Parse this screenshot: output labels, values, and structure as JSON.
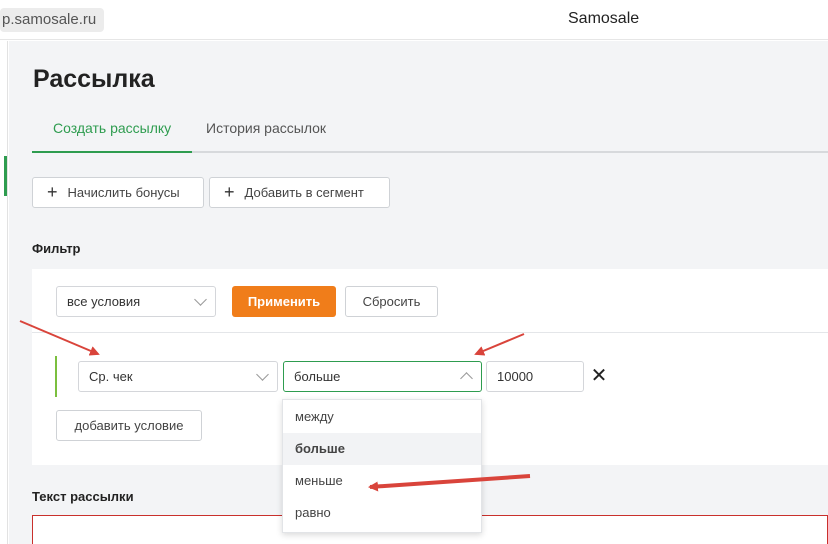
{
  "browser": {
    "url": "p.samosale.ru",
    "title": "Samosale"
  },
  "page": {
    "title": "Рассылка",
    "tabs": [
      {
        "label": "Создать рассылку",
        "active": true
      },
      {
        "label": "История рассылок",
        "active": false
      }
    ],
    "actions": {
      "add_bonus": "Начислить бонусы",
      "add_segment": "Добавить в сегмент"
    }
  },
  "filter": {
    "section_label": "Фильтр",
    "conditions_mode": "все условия",
    "apply_label": "Применить",
    "reset_label": "Сбросить",
    "condition": {
      "field": "Ср. чек",
      "operator": "больше",
      "value": "10000",
      "clear_icon": "close-icon"
    },
    "add_condition_label": "добавить условие",
    "operator_options": [
      {
        "label": "между",
        "selected": false
      },
      {
        "label": "больше",
        "selected": true
      },
      {
        "label": "меньше",
        "selected": false
      },
      {
        "label": "равно",
        "selected": false
      }
    ]
  },
  "message": {
    "section_label": "Текст рассылки"
  },
  "colors": {
    "accent_green": "#2e9c4f",
    "apply_orange": "#f07d1a",
    "annotation_red": "#d9443b",
    "error_border": "#c9302c"
  }
}
